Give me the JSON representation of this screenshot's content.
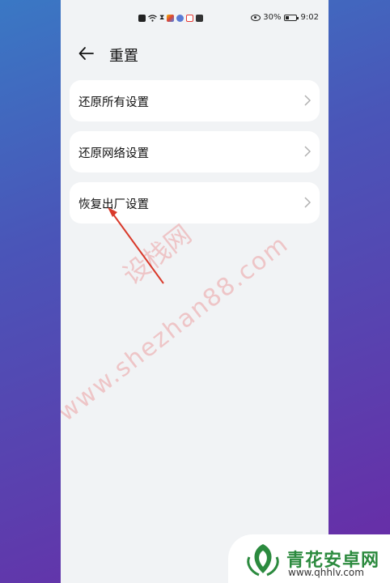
{
  "statusbar": {
    "battery_percent": "30%",
    "time": "9:02"
  },
  "header": {
    "title": "重置"
  },
  "items": [
    {
      "label": "还原所有设置"
    },
    {
      "label": "还原网络设置"
    },
    {
      "label": "恢复出厂设置"
    }
  ],
  "watermark": {
    "text_cn": "设栈网",
    "text_url": "www.shezhan88.com"
  },
  "logo": {
    "name": "青花安卓网",
    "url": "www.qhhlv.com"
  },
  "colors": {
    "accent_arrow": "#d93a2b",
    "logo_green": "#2b8a3e"
  },
  "icons": [
    "back-arrow-icon",
    "chevron-right-icon",
    "eye-icon",
    "battery-icon",
    "wifi-icon"
  ]
}
